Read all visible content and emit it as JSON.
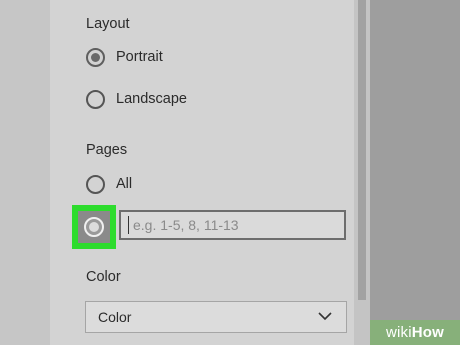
{
  "layout_section": {
    "heading": "Layout",
    "options": [
      {
        "label": "Portrait",
        "selected": true
      },
      {
        "label": "Landscape",
        "selected": false
      }
    ]
  },
  "pages_section": {
    "heading": "Pages",
    "options": [
      {
        "label": "All",
        "selected": false
      },
      {
        "label": "",
        "selected": true
      }
    ],
    "custom_range_placeholder": "e.g. 1-5, 8, 11-13",
    "custom_range_value": ""
  },
  "color_section": {
    "heading": "Color",
    "dropdown_value": "Color",
    "dropdown_icon": "chevron-down-icon"
  },
  "watermark": {
    "part1": "wiki",
    "part2": "How"
  },
  "colors": {
    "highlight": "#2ddc2d",
    "panel": "#d3d3d3"
  }
}
